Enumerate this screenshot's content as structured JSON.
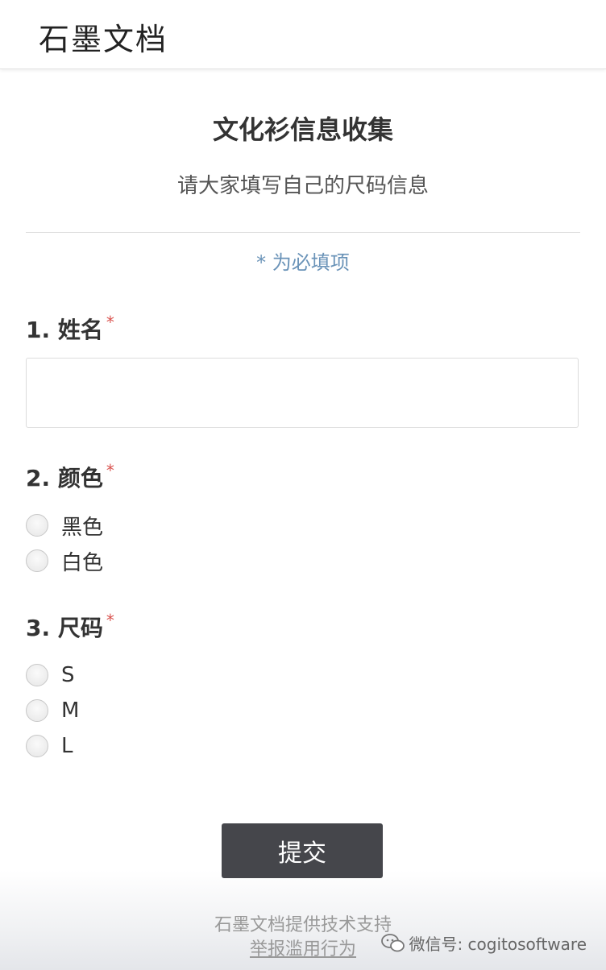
{
  "header": {
    "brand": "石墨文档"
  },
  "form": {
    "title": "文化衫信息收集",
    "description": "请大家填写自己的尺码信息",
    "required_note": "* 为必填项"
  },
  "questions": [
    {
      "number_label": "1. 姓名",
      "required_mark": "*",
      "type": "text",
      "value": ""
    },
    {
      "number_label": "2. 颜色",
      "required_mark": "*",
      "type": "radio",
      "options": [
        "黑色",
        "白色"
      ]
    },
    {
      "number_label": "3. 尺码",
      "required_mark": "*",
      "type": "radio",
      "options": [
        "S",
        "M",
        "L"
      ]
    }
  ],
  "submit_label": "提交",
  "footer": {
    "support": "石墨文档提供技术支持",
    "report": "举报滥用行为"
  },
  "watermark": {
    "text": "微信号: cogitosoftware",
    "icon": "wechat-icon"
  },
  "colors": {
    "required_star": "#d9534f",
    "required_note": "#6a93b8",
    "submit_button": "#45464b"
  }
}
